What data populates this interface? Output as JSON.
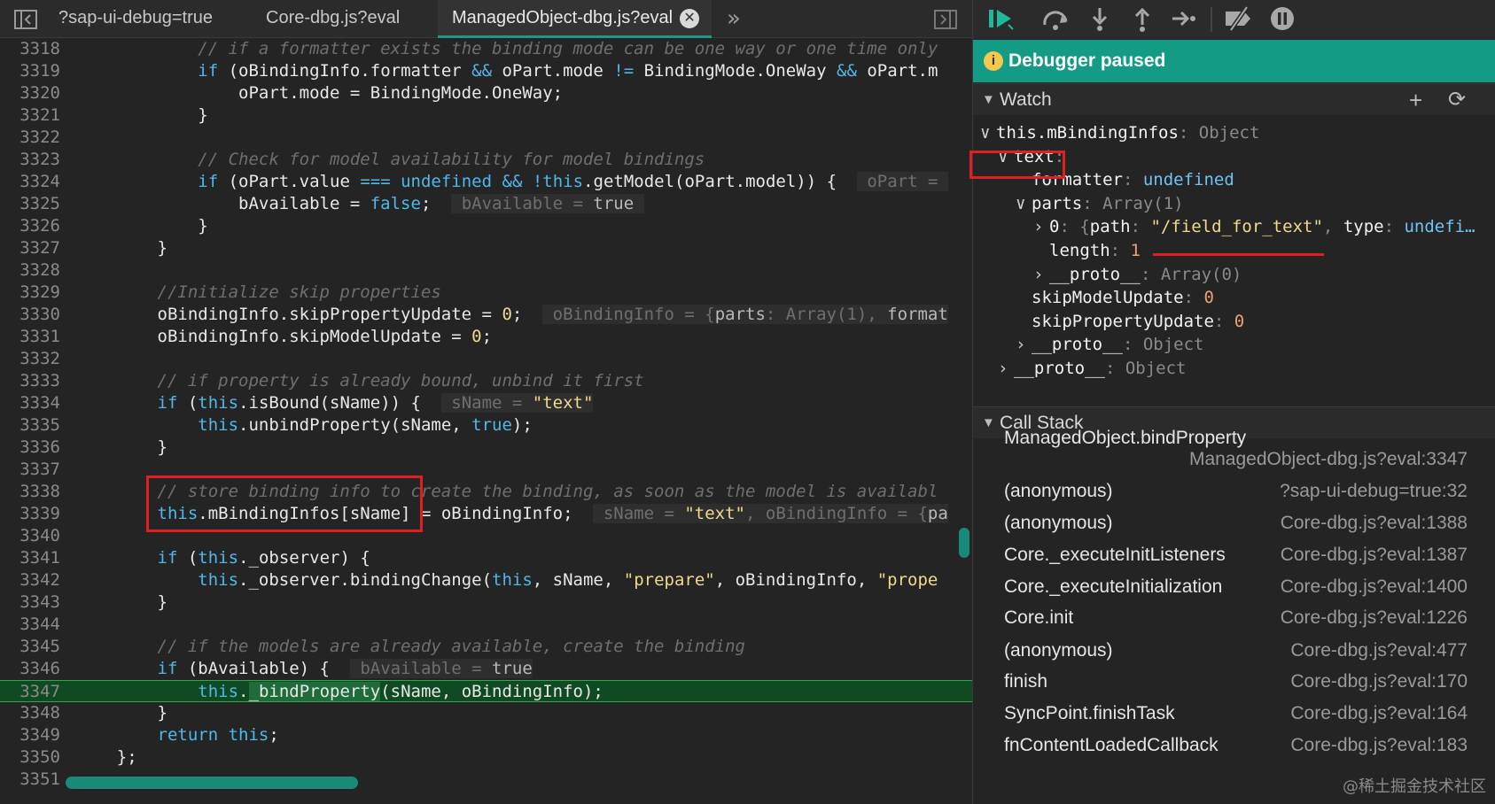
{
  "tabs": [
    {
      "label": "?sap-ui-debug=true"
    },
    {
      "label": "Core-dbg.js?eval"
    },
    {
      "label": "ManagedObject-dbg.js?eval",
      "close": "✕"
    }
  ],
  "tabbar": {
    "overflow": "»"
  },
  "editor": {
    "lines": [
      {
        "n": "3318",
        "html": "            <span class=\"cm\">// if a formatter exists the binding mode can be one way or one time only</span>"
      },
      {
        "n": "3319",
        "html": "            <span class=\"kw\">if</span> (oBindingInfo.formatter <span class=\"kw\">&amp;&amp;</span> oPart.mode <span class=\"kw\">!=</span> BindingMode.OneWay <span class=\"kw\">&amp;&amp;</span> oPart.m"
      },
      {
        "n": "3320",
        "html": "                oPart.mode = BindingMode.OneWay;"
      },
      {
        "n": "3321",
        "html": "            }"
      },
      {
        "n": "3322",
        "html": ""
      },
      {
        "n": "3323",
        "html": "            <span class=\"cm\">// Check for model availability for model bindings</span>"
      },
      {
        "n": "3324",
        "html": "            <span class=\"kw\">if</span> (oPart.value <span class=\"kw\">===</span> <span class=\"kw\">undefined</span> <span class=\"kw\">&amp;&amp;</span> <span class=\"kw\">!this</span>.getModel(oPart.model)) {  <span class=\"inl\"> oPart = </span>"
      },
      {
        "n": "3325",
        "html": "                bAvailable = <span class=\"kw\">false</span>;  <span class=\"inl\"> bAvailable = <b>true</b> </span>"
      },
      {
        "n": "3326",
        "html": "            }"
      },
      {
        "n": "3327",
        "html": "        }"
      },
      {
        "n": "3328",
        "html": ""
      },
      {
        "n": "3329",
        "html": "        <span class=\"cm\">//Initialize skip properties</span>"
      },
      {
        "n": "3330",
        "html": "        oBindingInfo.skipPropertyUpdate = <span class=\"num\">0</span>;  <span class=\"inl\"> oBindingInfo = {<b>parts</b>: Array(1), <b>format</b></span>"
      },
      {
        "n": "3331",
        "html": "        oBindingInfo.skipModelUpdate = <span class=\"num\">0</span>;"
      },
      {
        "n": "3332",
        "html": ""
      },
      {
        "n": "3333",
        "html": "        <span class=\"cm\">// if property is already bound, unbind it first</span>"
      },
      {
        "n": "3334",
        "html": "        <span class=\"kw\">if</span> (<span class=\"kw\">this</span>.isBound(sName)) {  <span class=\"inl\"> sName = <b style=\"color:#f0d98c\">\"text\"</b></span>"
      },
      {
        "n": "3335",
        "html": "            <span class=\"kw\">this</span>.unbindProperty(sName, <span class=\"kw\">true</span>);"
      },
      {
        "n": "3336",
        "html": "        }"
      },
      {
        "n": "3337",
        "html": ""
      },
      {
        "n": "3338",
        "html": "        <span class=\"cm\">// store binding info to create the binding, as soon as the model is availabl</span>"
      },
      {
        "n": "3339",
        "html": "        <span class=\"kw\">this</span>.mBindingInfos[sName] = oBindingInfo;  <span class=\"inl\"> sName = <b style=\"color:#f0d98c\">\"text\"</b>, oBindingInfo = {<b>pa</b></span>"
      },
      {
        "n": "3340",
        "html": ""
      },
      {
        "n": "3341",
        "html": "        <span class=\"kw\">if</span> (<span class=\"kw\">this</span>._observer) {"
      },
      {
        "n": "3342",
        "html": "            <span class=\"kw\">this</span>._observer.bindingChange(<span class=\"kw\">this</span>, sName, <span class=\"str\">\"prepare\"</span>, oBindingInfo, <span class=\"str\">\"prope</span>"
      },
      {
        "n": "3343",
        "html": "        }"
      },
      {
        "n": "3344",
        "html": ""
      },
      {
        "n": "3345",
        "html": "        <span class=\"cm\">// if the models are already available, create the binding</span>"
      },
      {
        "n": "3346",
        "html": "        <span class=\"kw\">if</span> (bAvailable) {  <span class=\"inl\"> bAvailable = <b>true</b></span>"
      },
      {
        "n": "3347",
        "html": "            <span class=\"kw\">this</span>.<span style=\"background:#1f6b3a\">_bindProperty</span>(sName, oBindingInfo);",
        "exec": true
      },
      {
        "n": "3348",
        "html": "        }"
      },
      {
        "n": "3349",
        "html": "        <span class=\"kw\">return this</span>;"
      },
      {
        "n": "3350",
        "html": "    };"
      },
      {
        "n": "3351",
        "html": ""
      }
    ]
  },
  "debugger": {
    "status": "Debugger paused",
    "info_icon": "i"
  },
  "watch": {
    "title": "Watch",
    "add": "+",
    "refresh": "⟳"
  },
  "watchTree": [
    {
      "indent": 0,
      "arrow": "v",
      "key": "this.mBindingInfos",
      "sep": ": ",
      "val": "Object",
      "vcls": "dim"
    },
    {
      "indent": 1,
      "arrow": "v",
      "key": "text",
      "sep": ":",
      "val": "",
      "vcls": "dim"
    },
    {
      "indent": 2,
      "arrow": "",
      "key": "formatter",
      "sep": ": ",
      "val": "undefined",
      "vcls": "val"
    },
    {
      "indent": 2,
      "arrow": "v",
      "key": "parts",
      "sep": ": ",
      "val": "Array(1)",
      "vcls": "dim"
    },
    {
      "indent": 3,
      "arrow": ">",
      "key": "0",
      "sep": ": ",
      "val": "{path: \"/field_for_text\", type: undefi…",
      "vcls": "mix"
    },
    {
      "indent": 3,
      "arrow": "",
      "key": "length",
      "sep": ": ",
      "val": "1",
      "vcls": "vnum"
    },
    {
      "indent": 3,
      "arrow": ">",
      "key": "__proto__",
      "sep": ": ",
      "val": "Array(0)",
      "vcls": "dim"
    },
    {
      "indent": 2,
      "arrow": "",
      "key": "skipModelUpdate",
      "sep": ": ",
      "val": "0",
      "vcls": "vnum"
    },
    {
      "indent": 2,
      "arrow": "",
      "key": "skipPropertyUpdate",
      "sep": ": ",
      "val": "0",
      "vcls": "vnum"
    },
    {
      "indent": 2,
      "arrow": ">",
      "key": "__proto__",
      "sep": ": ",
      "val": "Object",
      "vcls": "dim"
    },
    {
      "indent": 1,
      "arrow": ">",
      "key": "__proto__",
      "sep": ": ",
      "val": "Object",
      "vcls": "dim"
    }
  ],
  "callstack": {
    "title": "Call Stack",
    "frames": [
      {
        "fn": "ManagedObject.bindProperty",
        "loc": "ManagedObject-dbg.js?eval:3347"
      },
      {
        "fn": "(anonymous)",
        "loc": "?sap-ui-debug=true:32"
      },
      {
        "fn": "(anonymous)",
        "loc": "Core-dbg.js?eval:1388"
      },
      {
        "fn": "Core._executeInitListeners",
        "loc": "Core-dbg.js?eval:1387"
      },
      {
        "fn": "Core._executeInitialization",
        "loc": "Core-dbg.js?eval:1400"
      },
      {
        "fn": "Core.init",
        "loc": "Core-dbg.js?eval:1226"
      },
      {
        "fn": "(anonymous)",
        "loc": "Core-dbg.js?eval:477"
      },
      {
        "fn": "finish",
        "loc": "Core-dbg.js?eval:170"
      },
      {
        "fn": "SyncPoint.finishTask",
        "loc": "Core-dbg.js?eval:164"
      },
      {
        "fn": "fnContentLoadedCallback",
        "loc": "Core-dbg.js?eval:183"
      }
    ]
  },
  "watermark": "@稀土掘金技术社区",
  "colors": {
    "accent": "#139b86",
    "highlight": "#e02020",
    "exec_line": "#0f4a23"
  },
  "icons": [
    "toggle-navigator-icon",
    "chevron-double-right-icon",
    "toggle-debugger-icon",
    "resume-icon",
    "step-over-icon",
    "step-into-icon",
    "step-out-icon",
    "step-icon",
    "deactivate-breakpoints-icon",
    "pause-on-exceptions-icon"
  ]
}
